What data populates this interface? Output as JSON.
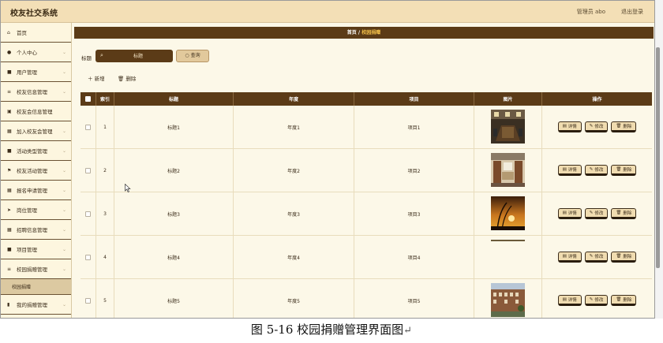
{
  "app": {
    "title": "校友社交系统",
    "admin": "管理员 abo",
    "logout": "退出登录"
  },
  "sidebar": {
    "items": [
      {
        "label": "首页",
        "icon": "home-icon",
        "glyph": "⌂",
        "chevron": false
      },
      {
        "label": "个人中心",
        "icon": "user-icon",
        "glyph": "●",
        "chevron": true
      },
      {
        "label": "用户管理",
        "icon": "users-icon",
        "glyph": "■",
        "chevron": true
      },
      {
        "label": "校友信息管理",
        "icon": "info-icon",
        "glyph": "≡",
        "chevron": true
      },
      {
        "label": "校友会信息管理",
        "icon": "building-icon",
        "glyph": "▣",
        "chevron": false
      },
      {
        "label": "加入校友会管理",
        "icon": "grid-icon",
        "glyph": "▦",
        "chevron": true
      },
      {
        "label": "活动类型管理",
        "icon": "tag-icon",
        "glyph": "■",
        "chevron": true
      },
      {
        "label": "校友活动管理",
        "icon": "flag-icon",
        "glyph": "⚑",
        "chevron": true
      },
      {
        "label": "报名申请管理",
        "icon": "grid-icon",
        "glyph": "▦",
        "chevron": true
      },
      {
        "label": "岗位管理",
        "icon": "send-icon",
        "glyph": "➤",
        "chevron": true
      },
      {
        "label": "招聘信息管理",
        "icon": "grid-icon",
        "glyph": "▦",
        "chevron": true
      },
      {
        "label": "项目管理",
        "icon": "box-icon",
        "glyph": "■",
        "chevron": true
      },
      {
        "label": "校园捐赠管理",
        "icon": "list-icon",
        "glyph": "≡",
        "chevron": true
      },
      {
        "label": "校园捐赠",
        "sub": true
      },
      {
        "label": "我的捐赠管理",
        "icon": "chart-icon",
        "glyph": "▮",
        "chevron": true
      }
    ]
  },
  "breadcrumb": {
    "home": "首页",
    "sep": "/",
    "current": "校园捐赠"
  },
  "search": {
    "label": "标题",
    "placeholder": "标题",
    "button": "查询"
  },
  "toolbar": {
    "add": "新增",
    "delete": "删除"
  },
  "table": {
    "columns": [
      "",
      "索引",
      "标题",
      "年度",
      "项目",
      "图片",
      "操作"
    ],
    "rows": [
      {
        "index": "1",
        "title": "标题1",
        "year": "年度1",
        "project": "项目1",
        "pic": "meeting-room"
      },
      {
        "index": "2",
        "title": "标题2",
        "year": "年度2",
        "project": "项目2",
        "pic": "library"
      },
      {
        "index": "3",
        "title": "标题3",
        "year": "年度3",
        "project": "项目3",
        "pic": "sunset"
      },
      {
        "index": "4",
        "title": "标题4",
        "year": "年度4",
        "project": "项目4",
        "pic": "blank"
      },
      {
        "index": "5",
        "title": "标题5",
        "year": "年度5",
        "project": "项目5",
        "pic": "campus-building"
      }
    ],
    "actions": {
      "detail": "详情",
      "edit": "修改",
      "delete": "删除"
    }
  },
  "caption": "图 5-16 校园捐赠管理界面图"
}
